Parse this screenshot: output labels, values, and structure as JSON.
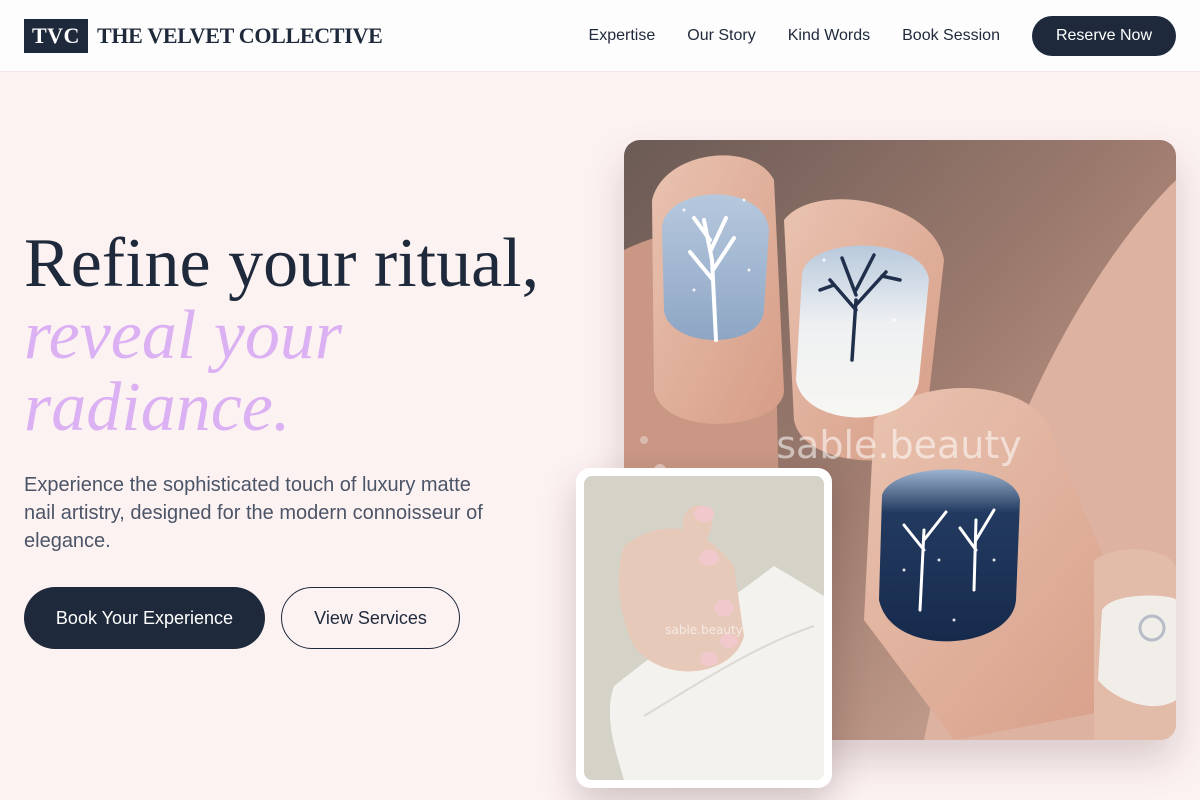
{
  "header": {
    "logo_mark": "TVC",
    "brand_name": "THE VELVET COLLECTIVE",
    "nav": [
      {
        "label": "Expertise"
      },
      {
        "label": "Our Story"
      },
      {
        "label": "Kind Words"
      },
      {
        "label": "Book Session"
      }
    ],
    "cta_label": "Reserve Now"
  },
  "hero": {
    "title_line1": "Refine your ritual,",
    "title_accent": "reveal your radiance.",
    "subtitle": "Experience the sophisticated touch of luxury matte nail artistry, designed for the modern connoisseur of elegance.",
    "primary_button": "Book Your Experience",
    "secondary_button": "View Services"
  },
  "images": {
    "main_watermark": "sable.beauty",
    "inset_watermark": "sable.beauty"
  },
  "colors": {
    "primary": "#1e293b",
    "accent": "#dbb1f3",
    "background": "#fdf2f2"
  }
}
